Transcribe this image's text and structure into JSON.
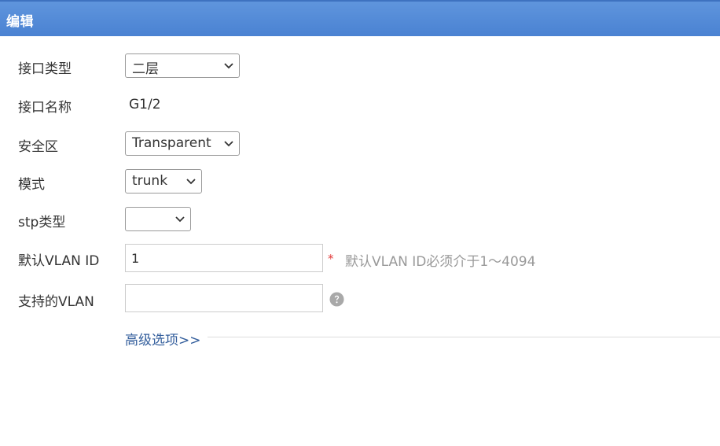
{
  "window": {
    "title": "编辑"
  },
  "form": {
    "interface_type": {
      "label": "接口类型",
      "value": "二层"
    },
    "interface_name": {
      "label": "接口名称",
      "value": "G1/2"
    },
    "security_zone": {
      "label": "安全区",
      "value": "Transparent"
    },
    "mode": {
      "label": "模式",
      "value": "trunk"
    },
    "stp_type": {
      "label": "stp类型",
      "value": ""
    },
    "default_vlan": {
      "label": "默认VLAN ID",
      "value": "1",
      "required_mark": "*",
      "hint": "默认VLAN ID必须介于1～4094"
    },
    "supported_vlan": {
      "label": "支持的VLAN",
      "value": "",
      "help_icon": "question-circle-icon"
    },
    "advanced_link": "高级选项>>"
  },
  "colors": {
    "titlebar": "#4f88d6",
    "link": "#335e9c",
    "required": "#e23b3b",
    "hint": "#999999"
  }
}
